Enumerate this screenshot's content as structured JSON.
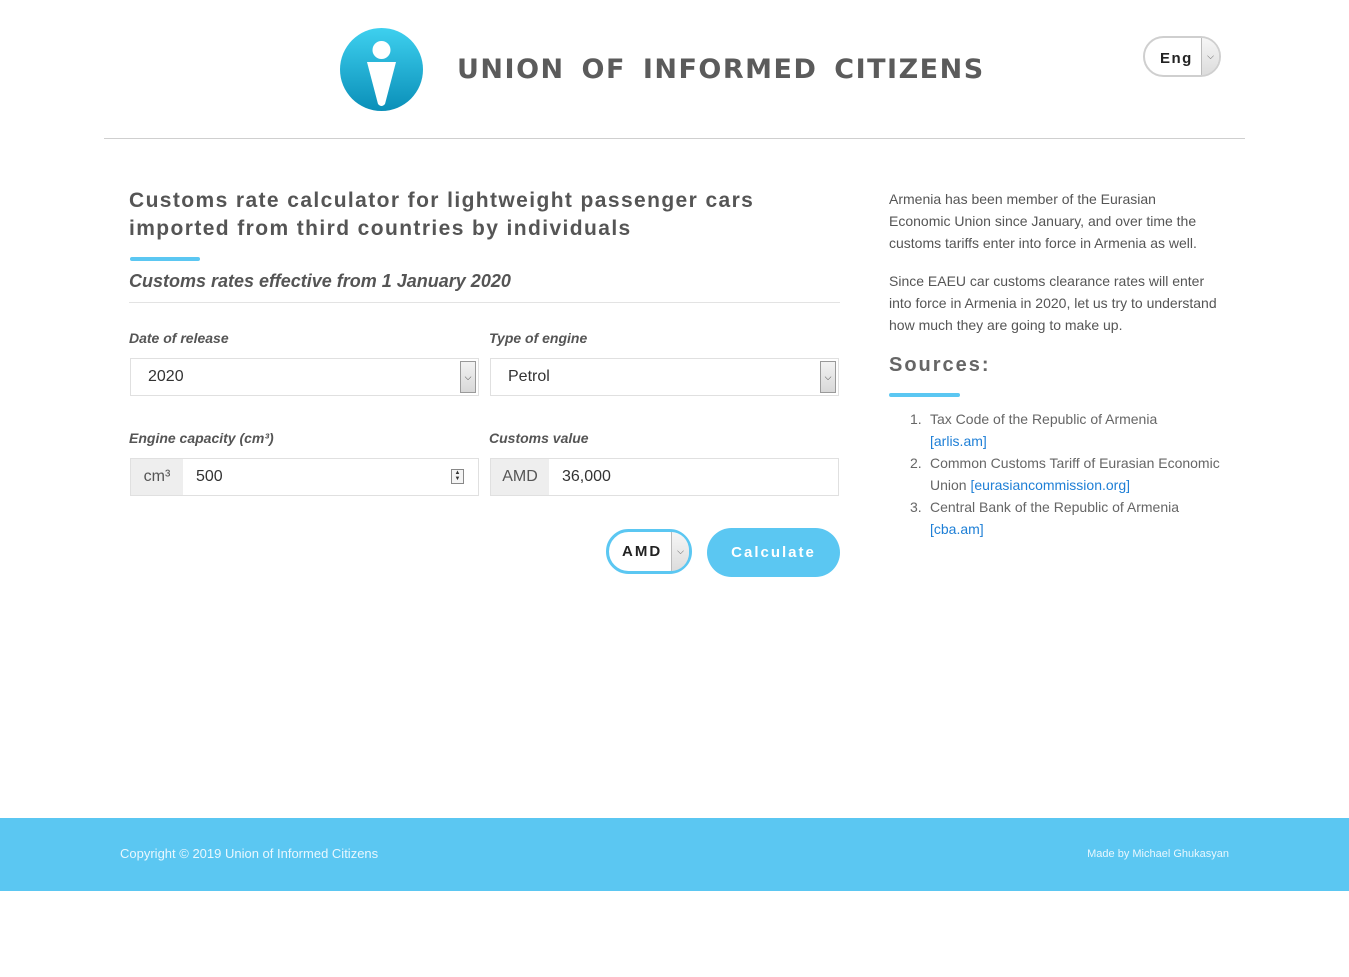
{
  "header": {
    "site_name": "UNION  OF  INFORMED  CITIZENS",
    "language": "Eng",
    "logo_icon": "person-pin-logo-icon"
  },
  "calculator": {
    "title": "Customs rate calculator for lightweight passenger cars imported from third countries by individuals",
    "subtitle": "Customs rates effective from 1 January 2020",
    "date_of_release": {
      "label": "Date of release",
      "value": "2020"
    },
    "type_of_engine": {
      "label": "Type of engine",
      "value": "Petrol"
    },
    "engine_capacity": {
      "label": "Engine capacity (cm³)",
      "unit": "cm³",
      "value": "500"
    },
    "customs_value": {
      "label": "Customs value",
      "unit": "AMD",
      "value": "36,000"
    },
    "currency": "AMD",
    "calculate_label": "Calculate"
  },
  "sidebar": {
    "para1": "Armenia has been member of the Eurasian Economic Union since January, and over time the customs tariffs enter into force in Armenia as well.",
    "para2": "Since EAEU car customs clearance rates will enter into force in Armenia in 2020, let us try to understand how much they are going to make up.",
    "sources_title": "Sources:",
    "sources": [
      {
        "num": "1.",
        "text": "Tax Code of the Republic of Armenia",
        "link": "[arlis.am]"
      },
      {
        "num": "2.",
        "text": "Common Customs Tariff of Eurasian Economic Union",
        "link": "[eurasiancommission.org]"
      },
      {
        "num": "3.",
        "text": "Central Bank of the Republic of Armenia",
        "link": "[cba.am]"
      }
    ]
  },
  "footer": {
    "copyright": "Copyright © 2019 Union of Informed Citizens",
    "made_by": "Made by Michael Ghukasyan"
  },
  "colors": {
    "accent": "#5bc7f2",
    "link": "#1e7fd6",
    "text": "#555555"
  }
}
